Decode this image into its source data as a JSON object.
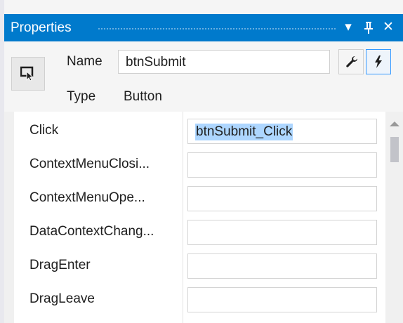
{
  "titlebar": {
    "title": "Properties",
    "dropdown_glyph": "▾",
    "pin_glyph": "ᛘ",
    "close_glyph": "✕"
  },
  "header": {
    "name_label": "Name",
    "name_value": "btnSubmit",
    "type_label": "Type",
    "type_value": "Button",
    "object_icon": "cursor-select-icon",
    "properties_button_icon": "wrench-icon",
    "events_button_icon": "lightning-bolt-icon"
  },
  "events": [
    {
      "name": "Click",
      "value": "btnSubmit_Click",
      "selected": true
    },
    {
      "name": "ContextMenuClosi...",
      "value": ""
    },
    {
      "name": "ContextMenuOpe...",
      "value": ""
    },
    {
      "name": "DataContextChang...",
      "value": ""
    },
    {
      "name": "DragEnter",
      "value": ""
    },
    {
      "name": "DragLeave",
      "value": ""
    }
  ],
  "colors": {
    "titlebar_bg": "#007acc",
    "selection": "#add6ff",
    "active_toggle_border": "#3399ff"
  }
}
